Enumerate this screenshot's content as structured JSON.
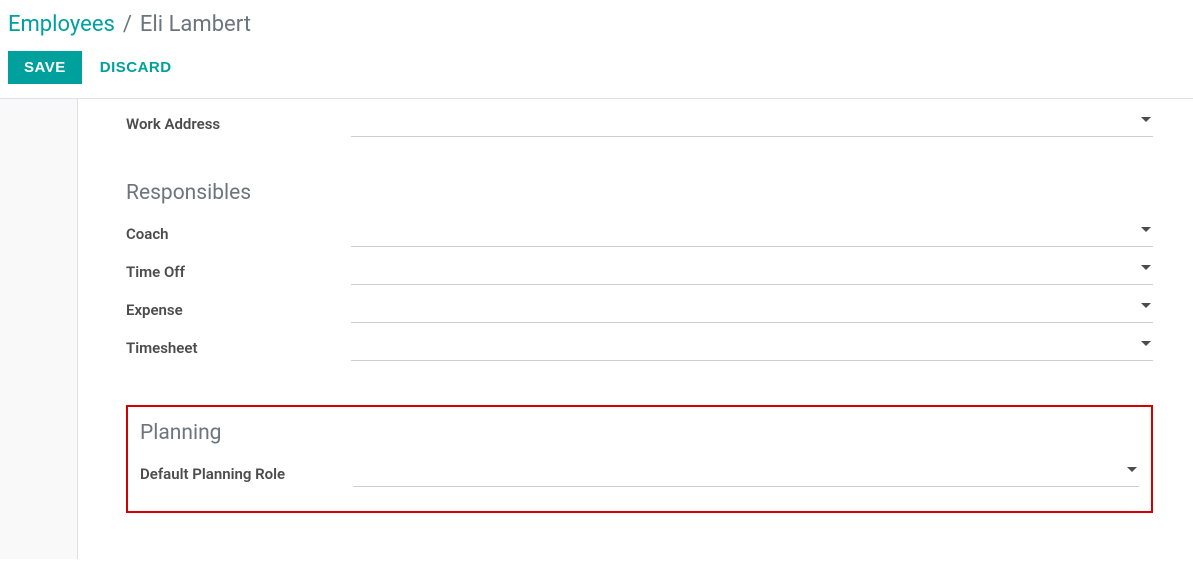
{
  "breadcrumb": {
    "root": "Employees",
    "separator": "/",
    "current": "Eli Lambert"
  },
  "actions": {
    "save": "SAVE",
    "discard": "DISCARD"
  },
  "fields": {
    "work_address": "Work Address"
  },
  "responsibles": {
    "heading": "Responsibles",
    "coach": "Coach",
    "time_off": "Time Off",
    "expense": "Expense",
    "timesheet": "Timesheet"
  },
  "planning": {
    "heading": "Planning",
    "default_role": "Default Planning Role"
  }
}
